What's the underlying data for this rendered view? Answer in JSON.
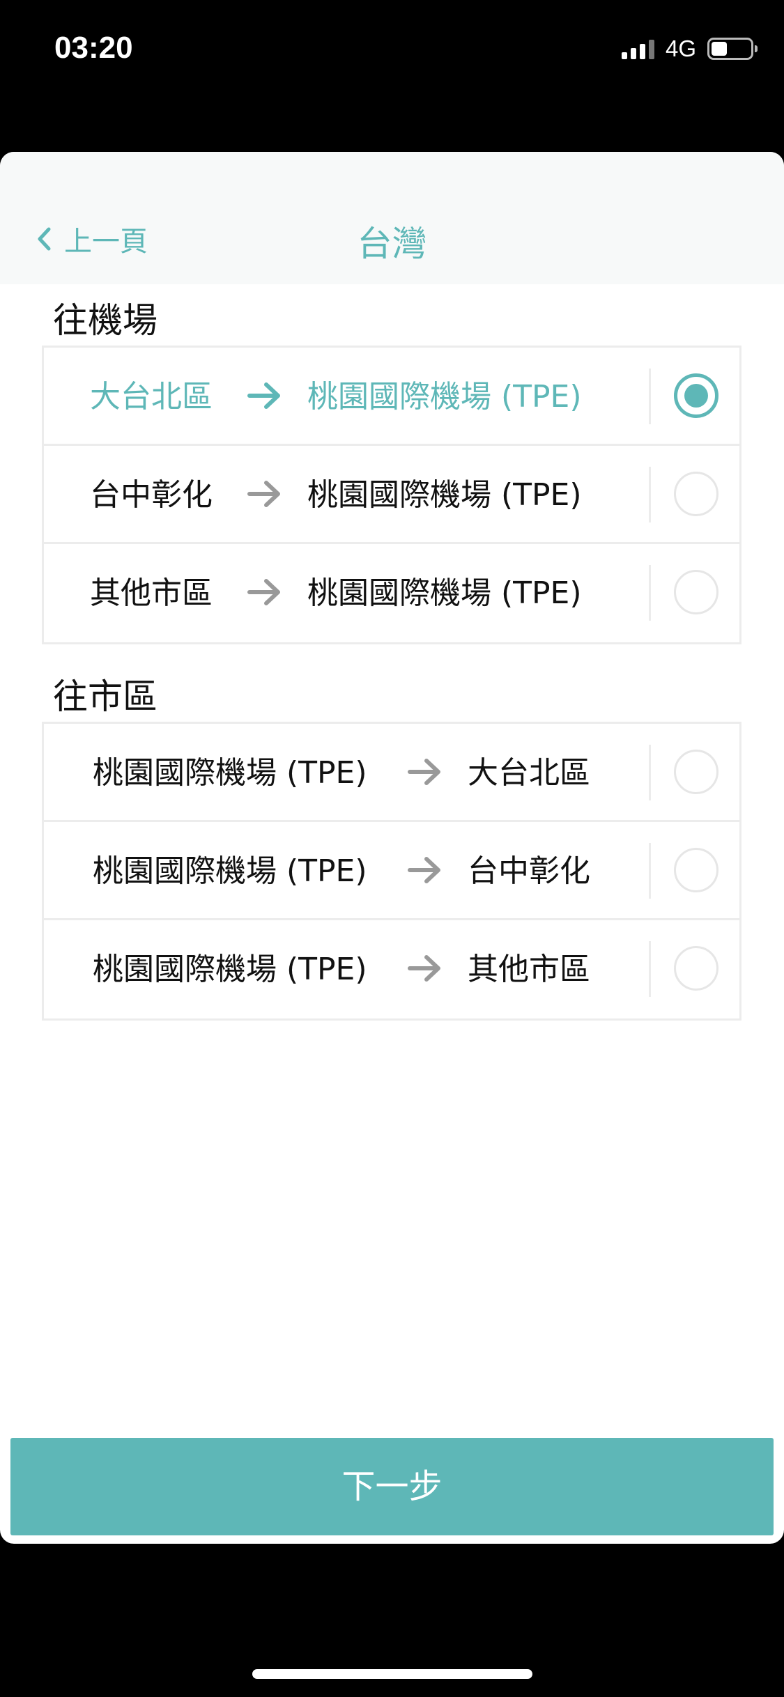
{
  "status_bar": {
    "time": "03:20",
    "network": "4G"
  },
  "nav": {
    "back_label": "上一頁",
    "title": "台灣"
  },
  "sections": {
    "to_airport": {
      "title": "往機場",
      "rows": [
        {
          "from": "大台北區",
          "to": "桃園國際機場 (TPE)",
          "selected": true
        },
        {
          "from": "台中彰化",
          "to": "桃園國際機場 (TPE)",
          "selected": false
        },
        {
          "from": "其他市區",
          "to": "桃園國際機場 (TPE)",
          "selected": false
        }
      ]
    },
    "to_city": {
      "title": "往市區",
      "rows": [
        {
          "from": "桃園國際機場 (TPE)",
          "to": "大台北區",
          "selected": false
        },
        {
          "from": "桃園國際機場 (TPE)",
          "to": "台中彰化",
          "selected": false
        },
        {
          "from": "桃園國際機場 (TPE)",
          "to": "其他市區",
          "selected": false
        }
      ]
    }
  },
  "next_button": {
    "label": "下一步"
  },
  "colors": {
    "accent": "#5eb7b7",
    "text": "#111111",
    "arrow": "#999999",
    "border": "#ececec"
  }
}
